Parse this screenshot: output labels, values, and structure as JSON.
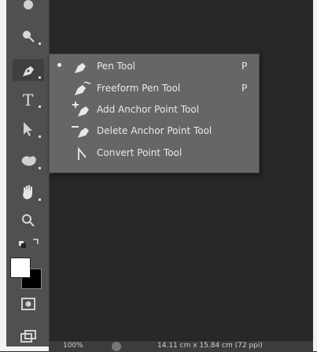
{
  "menu": {
    "items": [
      {
        "label": "Pen Tool",
        "key": "P",
        "selected": true,
        "icon": "pen-icon"
      },
      {
        "label": "Freeform Pen Tool",
        "key": "P",
        "selected": false,
        "icon": "freeform-pen-icon"
      },
      {
        "label": "Add Anchor Point Tool",
        "key": "",
        "selected": false,
        "icon": "add-anchor-point-icon"
      },
      {
        "label": "Delete Anchor Point Tool",
        "key": "",
        "selected": false,
        "icon": "delete-anchor-point-icon"
      },
      {
        "label": "Convert Point Tool",
        "key": "",
        "selected": false,
        "icon": "convert-point-icon"
      }
    ]
  },
  "toolbar": {
    "tools": [
      "burn-icon",
      "zoom-like-magnifier-icon",
      "pen-icon",
      "type-icon",
      "path-selection-icon",
      "shape-icon",
      "hand-icon",
      "zoom-icon",
      "swap-colors-icon"
    ],
    "active_tool": "pen-icon"
  },
  "colors": {
    "foreground": "#ffffff",
    "background": "#000000"
  },
  "status": {
    "zoom": "100%",
    "doc_info": "14.11 cm x 15.84 cm (72 ppi)"
  }
}
